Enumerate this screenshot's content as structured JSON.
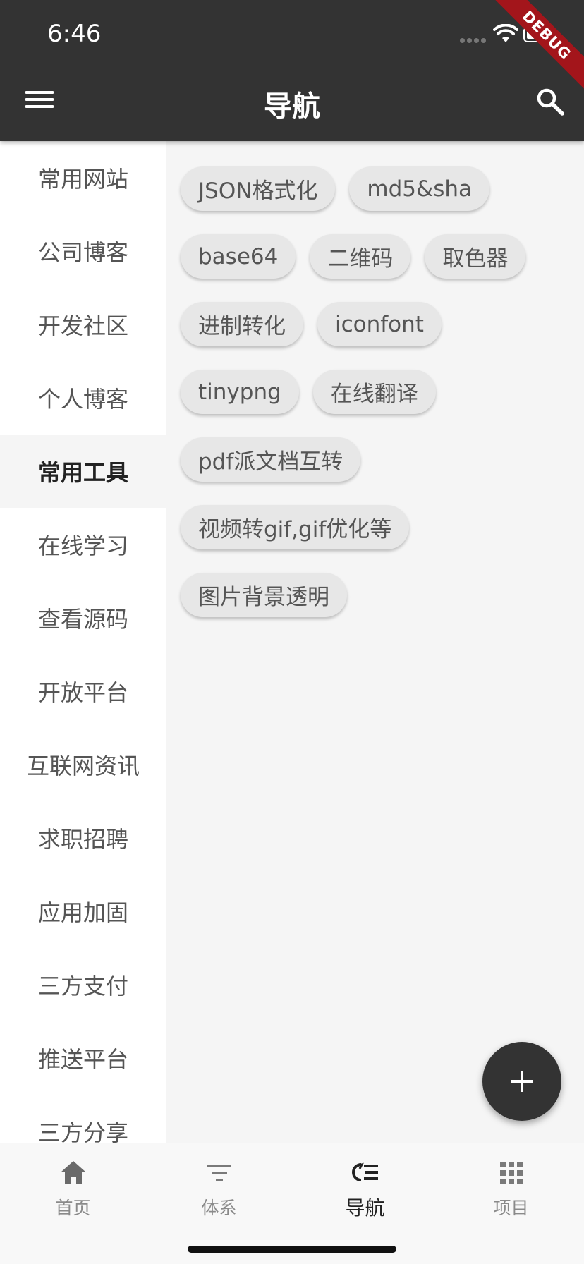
{
  "status_bar": {
    "time": "6:46",
    "debug_label": "DEBUG"
  },
  "header": {
    "title": "导航",
    "menu_icon": "menu-icon",
    "search_icon": "search-icon"
  },
  "sidebar": {
    "items": [
      {
        "label": "常用网站"
      },
      {
        "label": "公司博客"
      },
      {
        "label": "开发社区"
      },
      {
        "label": "个人博客"
      },
      {
        "label": "常用工具",
        "active": true
      },
      {
        "label": "在线学习"
      },
      {
        "label": "查看源码"
      },
      {
        "label": "开放平台"
      },
      {
        "label": "互联网资讯"
      },
      {
        "label": "求职招聘"
      },
      {
        "label": "应用加固"
      },
      {
        "label": "三方支付"
      },
      {
        "label": "推送平台"
      },
      {
        "label": "三方分享"
      }
    ]
  },
  "chips": {
    "rows": [
      [
        "JSON格式化",
        "md5&sha"
      ],
      [
        "base64",
        "二维码",
        "取色器"
      ],
      [
        "进制转化",
        "iconfont"
      ],
      [
        "tinypng",
        "在线翻译"
      ],
      [
        "pdf派文档互转"
      ],
      [
        "视频转gif,gif优化等"
      ],
      [
        "图片背景透明"
      ]
    ]
  },
  "fab": {
    "icon": "plus-icon"
  },
  "bottom_nav": {
    "items": [
      {
        "label": "首页",
        "icon": "home-icon"
      },
      {
        "label": "体系",
        "icon": "filter-icon"
      },
      {
        "label": "导航",
        "icon": "navigation-list-icon",
        "active": true
      },
      {
        "label": "项目",
        "icon": "apps-grid-icon"
      }
    ]
  },
  "colors": {
    "appbar": "#333333",
    "background": "#f5f5f5",
    "chip": "#e7e7e7",
    "debug_ribbon": "#a3151b"
  }
}
